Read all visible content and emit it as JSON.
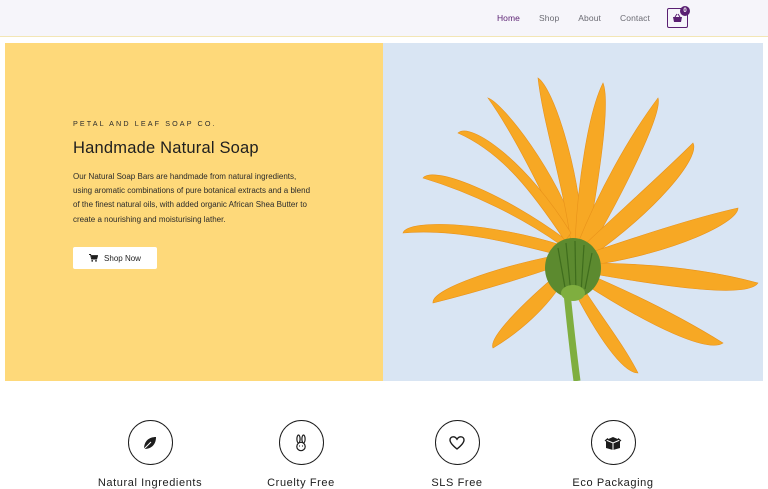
{
  "nav": {
    "items": [
      {
        "label": "Home",
        "active": true
      },
      {
        "label": "Shop",
        "active": false
      },
      {
        "label": "About",
        "active": false
      },
      {
        "label": "Contact",
        "active": false
      }
    ],
    "cart_count": "0",
    "accent_color": "#5a1f72"
  },
  "hero": {
    "eyebrow": "PETAL AND LEAF SOAP CO.",
    "title": "Handmade Natural Soap",
    "description": "Our Natural Soap Bars are handmade from natural ingredients, using aromatic combinations of pure botanical extracts and a blend of the finest natural oils, with added organic African Shea Butter to create a nourishing and moisturising lather.",
    "button_label": "Shop Now",
    "background_color": "#fed97a",
    "image_subject": "orange-calendula-flower"
  },
  "features": [
    {
      "label": "Natural Ingredients",
      "icon": "leaf-icon"
    },
    {
      "label": "Cruelty Free",
      "icon": "rabbit-icon"
    },
    {
      "label": "SLS Free",
      "icon": "heart-icon"
    },
    {
      "label": "Eco Packaging",
      "icon": "box-icon"
    }
  ]
}
